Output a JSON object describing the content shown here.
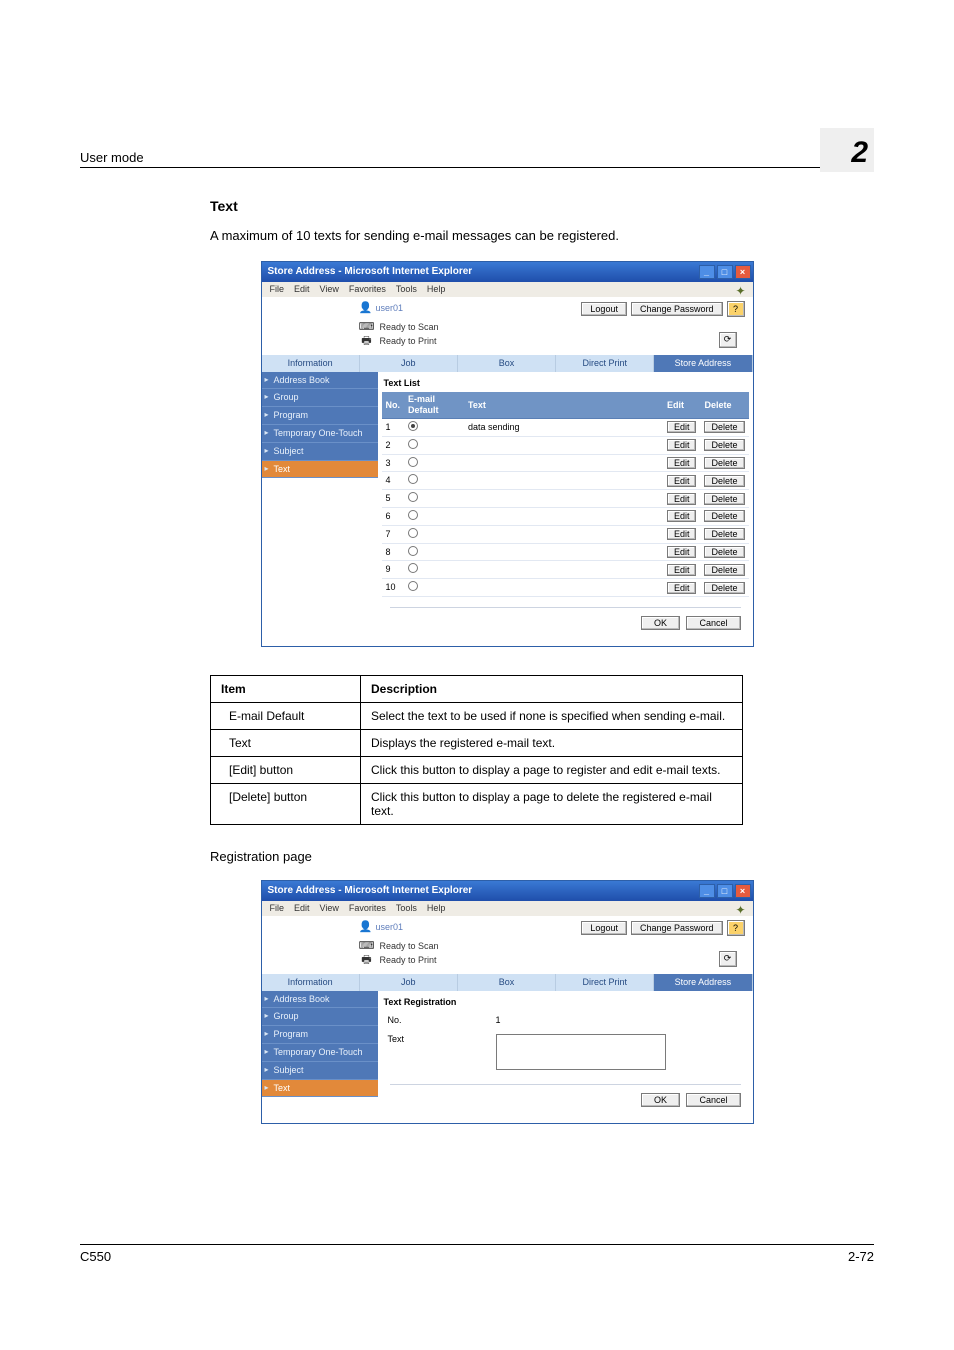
{
  "header": {
    "title": "User mode",
    "chapter": "2"
  },
  "section": {
    "title": "Text",
    "intro": "A maximum of 10 texts for sending e-mail messages can be registered."
  },
  "ie_window1": {
    "title": "Store Address - Microsoft Internet Explorer",
    "menus": [
      "File",
      "Edit",
      "View",
      "Favorites",
      "Tools",
      "Help"
    ],
    "user": "user01",
    "logout": "Logout",
    "change_pw": "Change Password",
    "status1": "Ready to Scan",
    "status2": "Ready to Print",
    "tabs": [
      "Information",
      "Job",
      "Box",
      "Direct Print",
      "Store Address"
    ],
    "active_tab": 4,
    "sidebar": [
      "Address Book",
      "Group",
      "Program",
      "Temporary One-Touch",
      "Subject",
      "Text"
    ],
    "active_side": 5,
    "panel_title": "Text List",
    "list_headers": {
      "no": "No.",
      "default": "E-mail Default",
      "text": "Text",
      "edit": "Edit",
      "delete": "Delete"
    },
    "rows": [
      {
        "no": "1",
        "checked": true,
        "text": "data sending"
      },
      {
        "no": "2",
        "checked": false,
        "text": ""
      },
      {
        "no": "3",
        "checked": false,
        "text": ""
      },
      {
        "no": "4",
        "checked": false,
        "text": ""
      },
      {
        "no": "5",
        "checked": false,
        "text": ""
      },
      {
        "no": "6",
        "checked": false,
        "text": ""
      },
      {
        "no": "7",
        "checked": false,
        "text": ""
      },
      {
        "no": "8",
        "checked": false,
        "text": ""
      },
      {
        "no": "9",
        "checked": false,
        "text": ""
      },
      {
        "no": "10",
        "checked": false,
        "text": ""
      }
    ],
    "edit_btn": "Edit",
    "delete_btn": "Delete",
    "ok": "OK",
    "cancel": "Cancel"
  },
  "desc": {
    "thead": {
      "item": "Item",
      "description": "Description"
    },
    "rows": [
      {
        "item": "E-mail Default",
        "desc": "Select the text to be used if none is specified when sending e-mail."
      },
      {
        "item": "Text",
        "desc": "Displays the registered e-mail text."
      },
      {
        "item": "[Edit] button",
        "desc": "Click this button to display a page to register and edit e-mail texts."
      },
      {
        "item": "[Delete] button",
        "desc": "Click this button to display a page to delete the registered e-mail text."
      }
    ]
  },
  "reg_caption": "Registration page",
  "ie_window2": {
    "panel_title": "Text Registration",
    "no_label": "No.",
    "no_value": "1",
    "text_label": "Text",
    "text_value": ""
  },
  "footer": {
    "left": "C550",
    "right": "2-72"
  }
}
